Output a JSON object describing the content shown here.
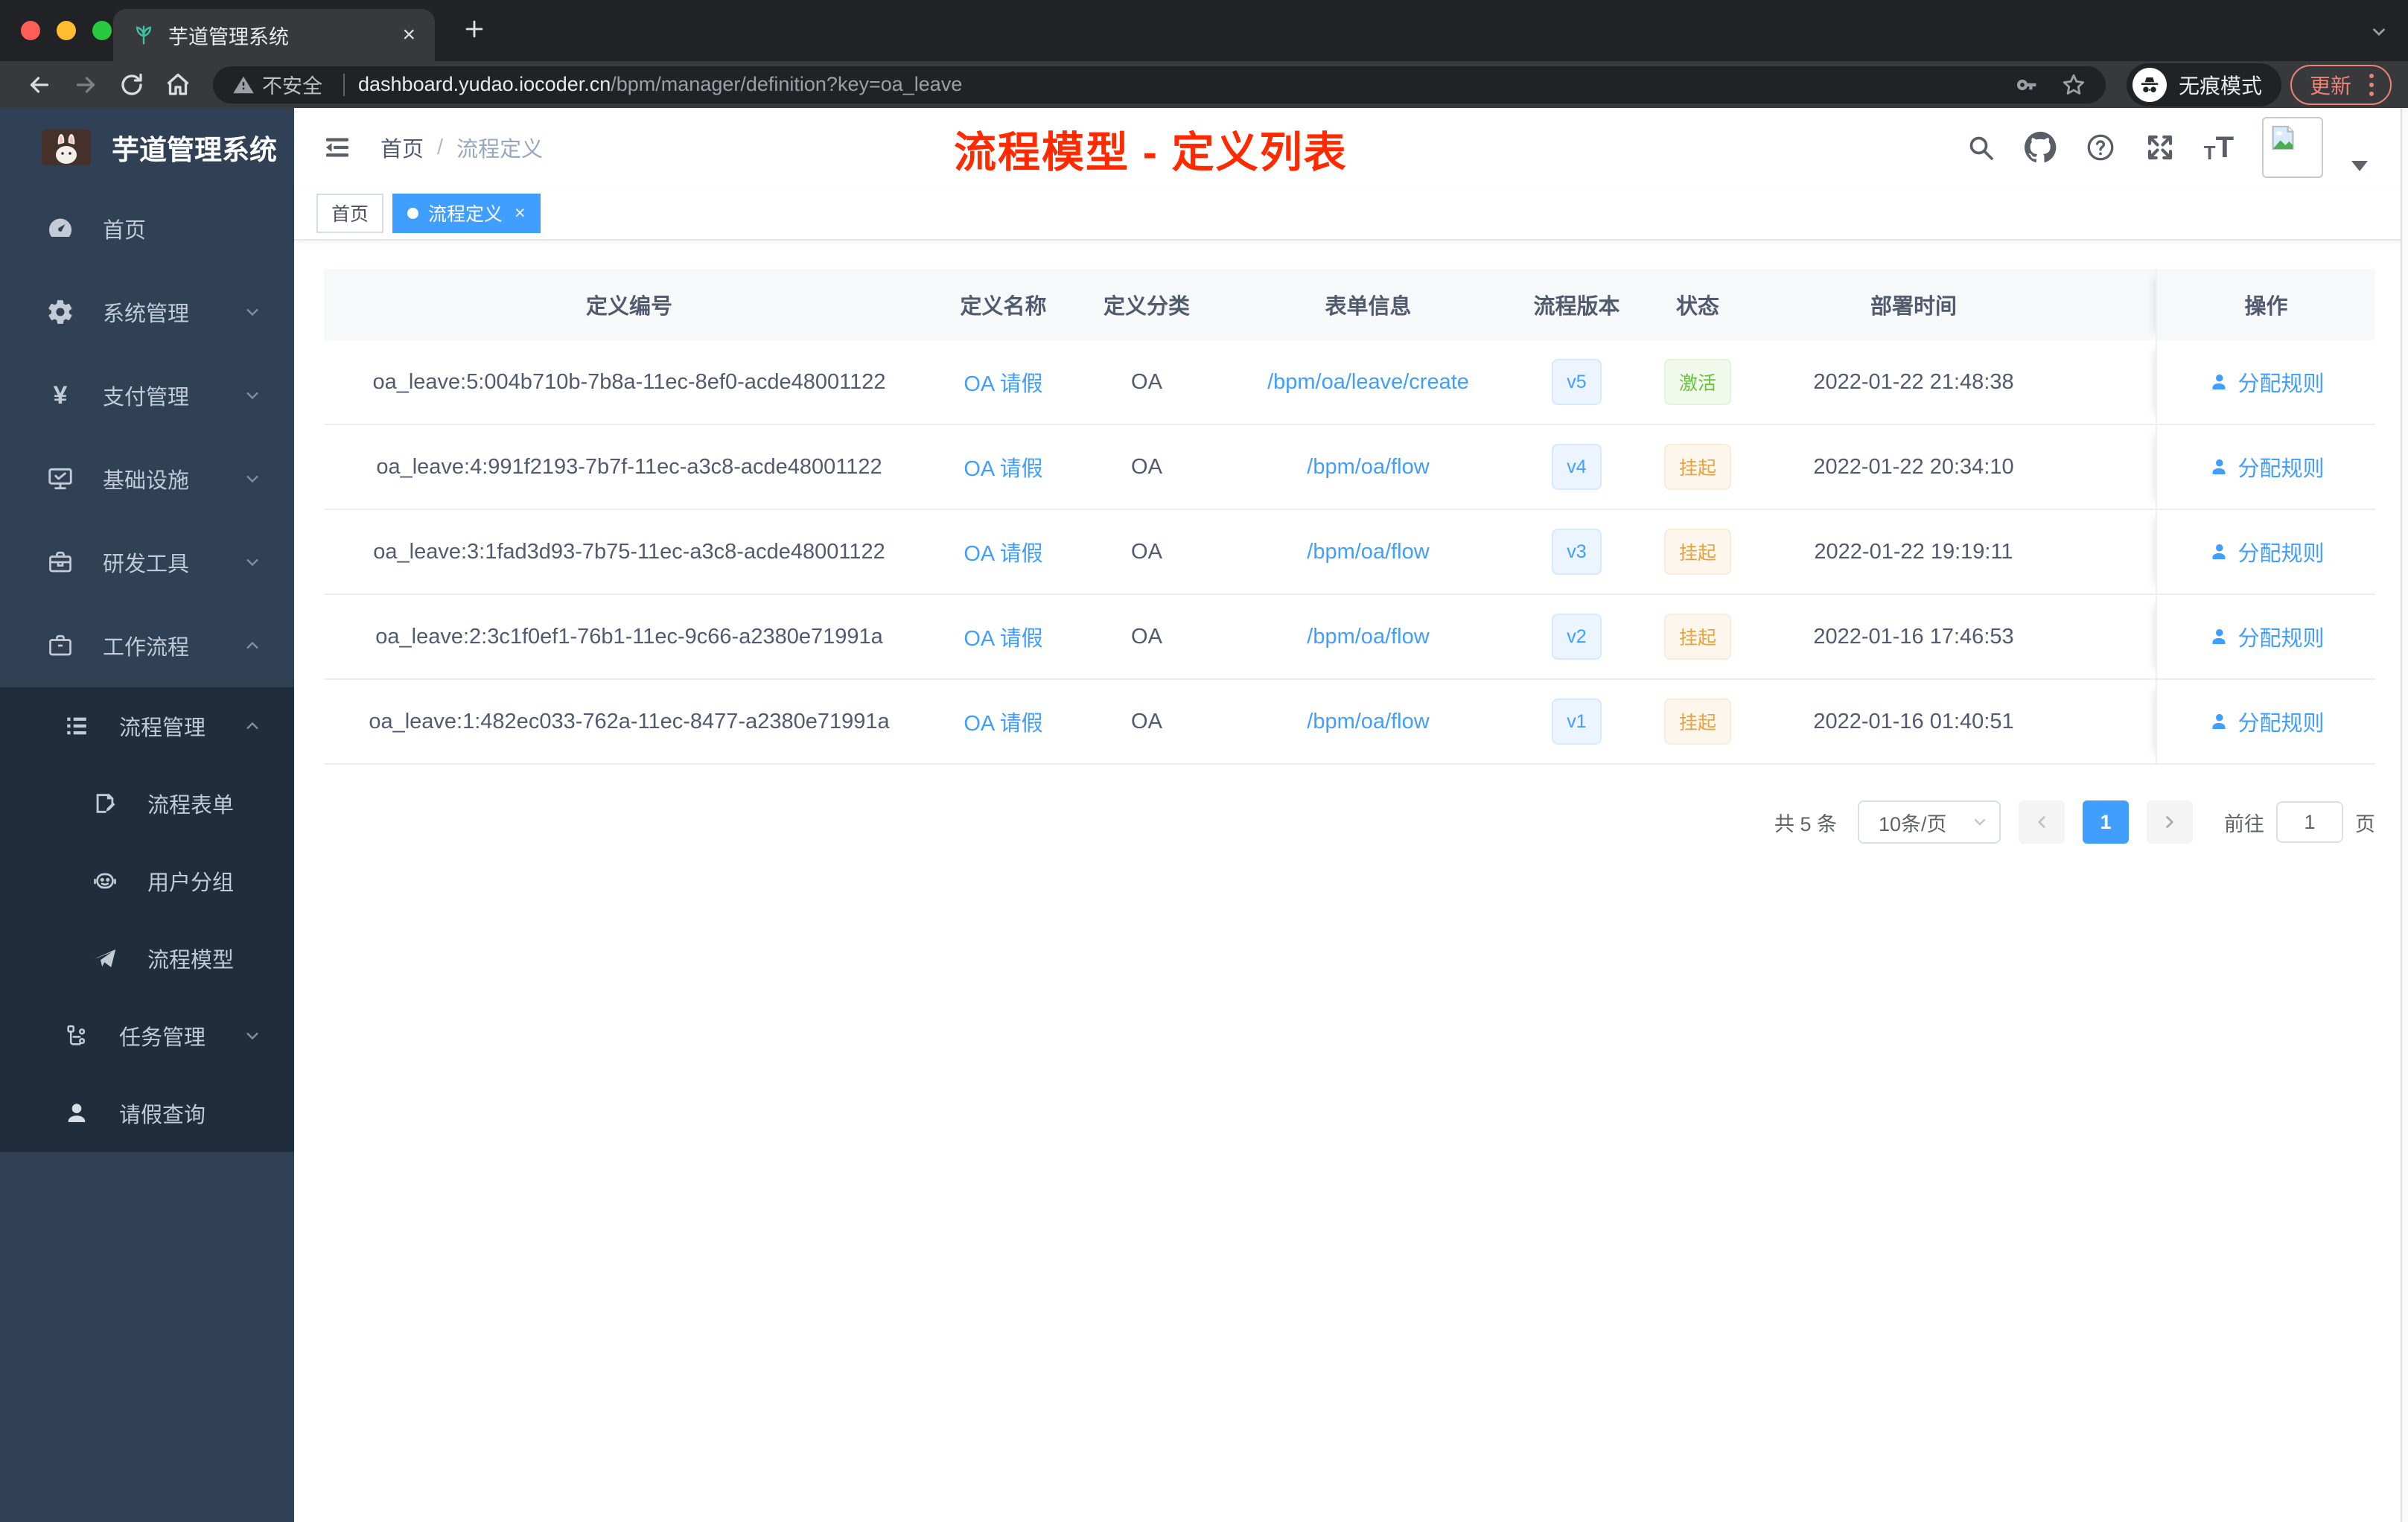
{
  "browser": {
    "tab_title": "芋道管理系统",
    "security_label": "不安全",
    "url_domain": "dashboard.yudao.iocoder.cn",
    "url_path": "/bpm/manager/definition?key=oa_leave",
    "incognito_label": "无痕模式",
    "update_label": "更新"
  },
  "icons": {
    "close": "×",
    "tag_close": "×",
    "caret_down": "⌄",
    "chevron_left": "‹",
    "chevron_right": "›",
    "yen": "¥"
  },
  "sidebar": {
    "logo_title": "芋道管理系统",
    "items": [
      {
        "label": "首页",
        "icon": "dashboard-icon"
      },
      {
        "label": "系统管理",
        "icon": "gear-icon",
        "expandable": true
      },
      {
        "label": "支付管理",
        "icon": "yen-icon",
        "expandable": true
      },
      {
        "label": "基础设施",
        "icon": "monitor-icon",
        "expandable": true
      },
      {
        "label": "研发工具",
        "icon": "toolbox-icon",
        "expandable": true
      },
      {
        "label": "工作流程",
        "icon": "briefcase-icon",
        "expandable": true,
        "expanded": true
      }
    ],
    "submenu": [
      {
        "label": "流程管理",
        "icon": "list-icon",
        "expandable": true,
        "expanded": true
      },
      {
        "label": "流程表单",
        "icon": "form-icon",
        "child": true
      },
      {
        "label": "用户分组",
        "icon": "robot-icon",
        "child": true
      },
      {
        "label": "流程模型",
        "icon": "paper-plane-icon",
        "child": true
      },
      {
        "label": "任务管理",
        "icon": "tree-icon",
        "expandable": true
      },
      {
        "label": "请假查询",
        "icon": "user-icon"
      }
    ]
  },
  "header": {
    "breadcrumb_home": "首页",
    "breadcrumb_separator": "/",
    "breadcrumb_current": "流程定义",
    "annotation": "流程模型 - 定义列表"
  },
  "tags": {
    "home": "首页",
    "active": "流程定义"
  },
  "table": {
    "headers": [
      "定义编号",
      "定义名称",
      "定义分类",
      "表单信息",
      "流程版本",
      "状态",
      "部署时间",
      "操作"
    ],
    "rows": [
      {
        "id": "oa_leave:5:004b710b-7b8a-11ec-8ef0-acde48001122",
        "name": "OA 请假",
        "category": "OA",
        "form": "/bpm/oa/leave/create",
        "version": "v5",
        "status": "激活",
        "status_type": "active",
        "time": "2022-01-22 21:48:38",
        "action": "分配规则"
      },
      {
        "id": "oa_leave:4:991f2193-7b7f-11ec-a3c8-acde48001122",
        "name": "OA 请假",
        "category": "OA",
        "form": "/bpm/oa/flow",
        "version": "v4",
        "status": "挂起",
        "status_type": "suspended",
        "time": "2022-01-22 20:34:10",
        "action": "分配规则"
      },
      {
        "id": "oa_leave:3:1fad3d93-7b75-11ec-a3c8-acde48001122",
        "name": "OA 请假",
        "category": "OA",
        "form": "/bpm/oa/flow",
        "version": "v3",
        "status": "挂起",
        "status_type": "suspended",
        "time": "2022-01-22 19:19:11",
        "action": "分配规则"
      },
      {
        "id": "oa_leave:2:3c1f0ef1-76b1-11ec-9c66-a2380e71991a",
        "name": "OA 请假",
        "category": "OA",
        "form": "/bpm/oa/flow",
        "version": "v2",
        "status": "挂起",
        "status_type": "suspended",
        "time": "2022-01-16 17:46:53",
        "action": "分配规则"
      },
      {
        "id": "oa_leave:1:482ec033-762a-11ec-8477-a2380e71991a",
        "name": "OA 请假",
        "category": "OA",
        "form": "/bpm/oa/flow",
        "version": "v1",
        "status": "挂起",
        "status_type": "suspended",
        "time": "2022-01-16 01:40:51",
        "action": "分配规则"
      }
    ]
  },
  "pagination": {
    "total": "共 5 条",
    "page_size": "10条/页",
    "current_page": "1",
    "goto_label": "前往",
    "goto_value": "1",
    "page_suffix": "页"
  },
  "colors": {
    "accent": "#409eff",
    "sidebar_bg": "#304156",
    "submenu_bg": "#1f2d3d",
    "annotation_red": "#ff2a00",
    "status_active": "#67c23a",
    "status_suspended": "#e6a23c",
    "update_button": "#ee8277"
  }
}
